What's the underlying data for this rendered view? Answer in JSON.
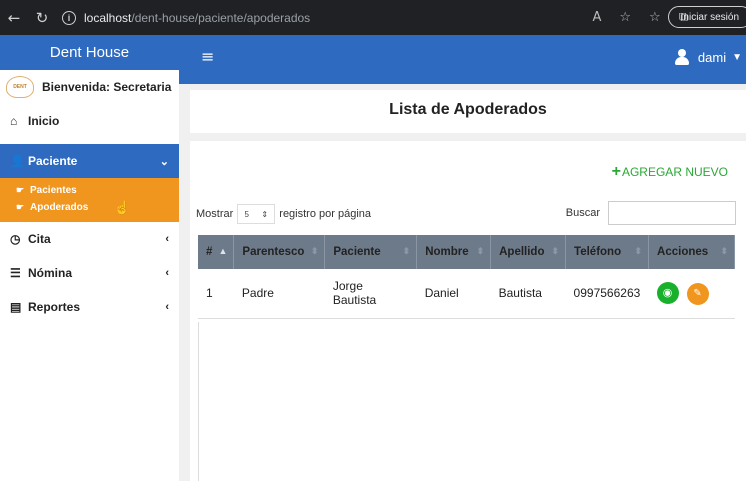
{
  "browser": {
    "url_host": "localhost",
    "url_path": "/dent-house/paciente/apoderados",
    "signin_label": "Iniciar sesión",
    "back_icon": "back-arrow-icon",
    "reload_icon": "reload-icon"
  },
  "sidebar": {
    "brand": "Dent House",
    "welcome": "Bienvenida: Secretaria",
    "items": [
      {
        "label": "Inicio",
        "icon": "home-icon",
        "arrow": ""
      },
      {
        "label": "Paciente",
        "icon": "user-icon",
        "arrow": "⌄"
      },
      {
        "label": "Cita",
        "icon": "clock-icon",
        "arrow": "‹"
      },
      {
        "label": "Nómina",
        "icon": "list-icon",
        "arrow": "‹"
      },
      {
        "label": "Reportes",
        "icon": "report-icon",
        "arrow": "‹"
      }
    ],
    "submenu": [
      {
        "label": "Pacientes",
        "icon": "hand-pointer-icon"
      },
      {
        "label": "Apoderados",
        "icon": "hand-pointer-icon"
      }
    ]
  },
  "topbar": {
    "user": "dami"
  },
  "page": {
    "title": "Lista de Apoderados",
    "add_label": "AGREGAR NUEVO",
    "show_prefix": "Mostrar",
    "show_value": "5",
    "show_suffix": "registro por página",
    "search_label": "Buscar",
    "search_value": ""
  },
  "table": {
    "columns": [
      "#",
      "Parentesco",
      "Paciente",
      "Nombre",
      "Apellido",
      "Teléfono",
      "Acciones"
    ],
    "rows": [
      [
        "1",
        "Padre",
        "Jorge Bautista",
        "Daniel",
        "Bautista",
        "0997566263"
      ]
    ]
  },
  "colors": {
    "primary": "#2e6bc0",
    "accent": "#f0951e",
    "success": "#2aa835",
    "table_header": "#6d7a8a"
  }
}
